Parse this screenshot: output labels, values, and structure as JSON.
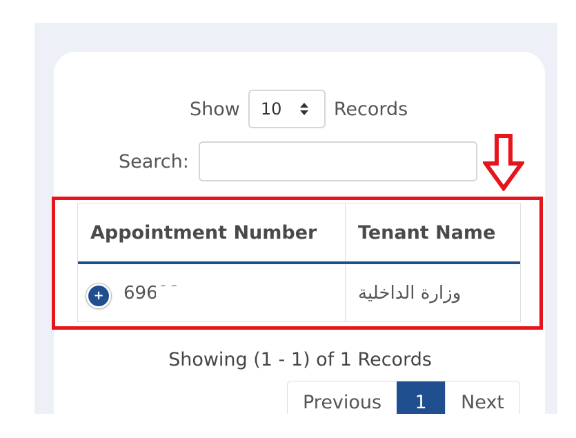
{
  "length_menu": {
    "show_label": "Show",
    "selected": "10",
    "records_label": "Records"
  },
  "search": {
    "label": "Search:",
    "value": ""
  },
  "table": {
    "headers": [
      "Appointment Number",
      "Tenant Name"
    ],
    "rows": [
      {
        "appointment_number": "69692",
        "tenant_name": "وزارة الداخلية"
      }
    ]
  },
  "summary": "Showing (1 - 1) of 1 Records",
  "pagination": {
    "previous": "Previous",
    "current_page": "1",
    "next": "Next"
  },
  "colors": {
    "accent": "#1f4f8e",
    "highlight": "#e8141c"
  },
  "icons": {
    "arrow": "arrow-down-outline-icon",
    "expand": "plus-circle-icon",
    "sort": "sort-updown-icon"
  }
}
